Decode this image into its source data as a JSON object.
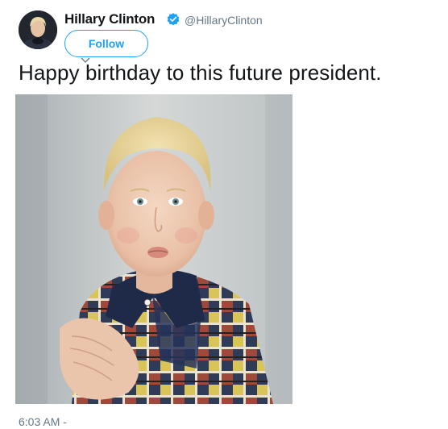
{
  "user": {
    "name": "Hillary Clinton",
    "handle": "@HillaryClinton",
    "verified": true,
    "avatar_icon": "profile-photo"
  },
  "follow_button": {
    "label": "Follow"
  },
  "tweet": {
    "text": "Happy birthday to this future president.",
    "timestamp": "6:03 AM -"
  },
  "media": {
    "type": "photo",
    "description_icon": "vintage-portrait-photo"
  },
  "colors": {
    "accent": "#1da1f2",
    "text": "#14171a",
    "secondary_text": "#657786"
  }
}
